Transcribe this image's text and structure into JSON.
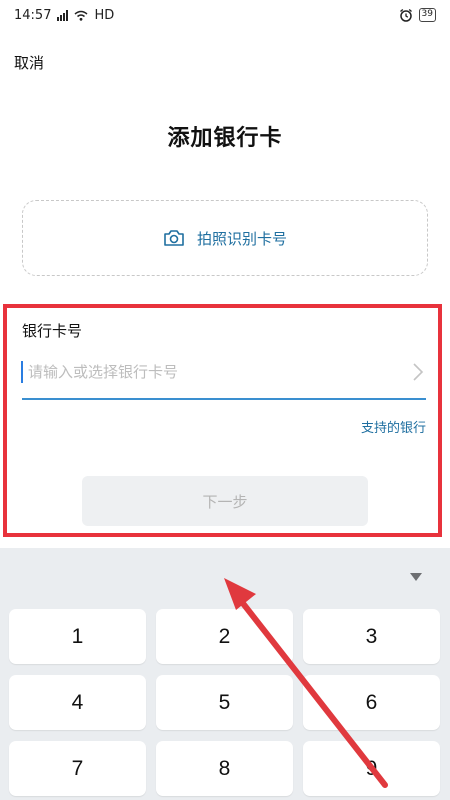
{
  "status_bar": {
    "time": "14:57",
    "network": "HD",
    "battery": "39"
  },
  "header": {
    "cancel_label": "取消",
    "title": "添加银行卡"
  },
  "photo_scan": {
    "label": "拍照识别卡号",
    "icon": "camera-icon"
  },
  "card_form": {
    "label": "银行卡号",
    "placeholder": "请输入或选择银行卡号",
    "value": "",
    "supported_banks_link": "支持的银行",
    "next_button": "下一步"
  },
  "keyboard": {
    "keys": [
      "1",
      "2",
      "3",
      "4",
      "5",
      "6",
      "7",
      "8",
      "9"
    ]
  },
  "colors": {
    "accent": "#1f6fa0",
    "highlight_box": "#e8323c",
    "arrow": "#e0393e",
    "keyboard_bg": "#eaedf0"
  }
}
